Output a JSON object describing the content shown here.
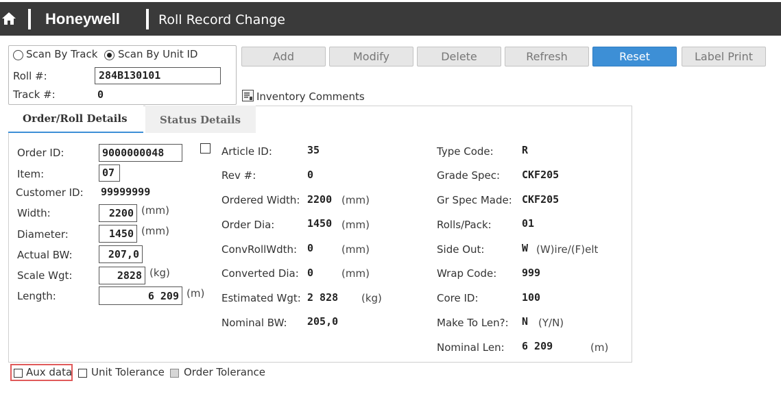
{
  "header": {
    "brand": "Honeywell",
    "title": "Roll Record Change",
    "home_icon": "home-icon"
  },
  "scan": {
    "option_track": "Scan By Track",
    "option_unit": "Scan By Unit ID",
    "selected": "unit",
    "roll_label": "Roll #:",
    "roll_value": "284B130101",
    "track_label": "Track #:",
    "track_value": "0"
  },
  "toolbar": {
    "add": "Add",
    "modify": "Modify",
    "delete": "Delete",
    "refresh": "Refresh",
    "reset": "Reset",
    "label_print": "Label Print"
  },
  "inventory_comments": "Inventory Comments",
  "tabs": {
    "order_roll": "Order/Roll Details",
    "status": "Status Details",
    "active": "order_roll"
  },
  "col1": {
    "order_id_label": "Order ID:",
    "order_id": "9000000048",
    "item_label": "Item:",
    "item": "07",
    "customer_id_label": "Customer ID:",
    "customer_id": "99999999",
    "width_label": "Width:",
    "width": "2200",
    "width_unit": "(mm)",
    "diameter_label": "Diameter:",
    "diameter": "1450",
    "diameter_unit": "(mm)",
    "actual_bw_label": "Actual BW:",
    "actual_bw": "207,0",
    "scale_wgt_label": "Scale Wgt:",
    "scale_wgt": "2828",
    "scale_wgt_unit": "(kg)",
    "length_label": "Length:",
    "length": "6 209",
    "length_unit": "(m)"
  },
  "col2": {
    "article_id_label": "Article ID:",
    "article_id": "35",
    "rev_label": "Rev #:",
    "rev": "0",
    "ordered_width_label": "Ordered Width:",
    "ordered_width": "2200",
    "ordered_width_unit": "(mm)",
    "order_dia_label": "Order Dia:",
    "order_dia": "1450",
    "order_dia_unit": "(mm)",
    "conv_roll_width_label": "ConvRollWdth:",
    "conv_roll_width": "0",
    "conv_roll_width_unit": "(mm)",
    "converted_dia_label": "Converted Dia:",
    "converted_dia": "0",
    "converted_dia_unit": "(mm)",
    "estimated_wgt_label": "Estimated Wgt:",
    "estimated_wgt": "2 828",
    "estimated_wgt_unit": "(kg)",
    "nominal_bw_label": "Nominal BW:",
    "nominal_bw": "205,0"
  },
  "col3": {
    "type_code_label": "Type Code:",
    "type_code": "R",
    "grade_spec_label": "Grade Spec:",
    "grade_spec": "CKF205",
    "gr_spec_made_label": "Gr Spec Made:",
    "gr_spec_made": "CKF205",
    "rolls_pack_label": "Rolls/Pack:",
    "rolls_pack": "01",
    "side_out_label": "Side Out:",
    "side_out": "W",
    "side_out_hint": "(W)ire/(F)elt",
    "wrap_code_label": "Wrap Code:",
    "wrap_code": "999",
    "core_id_label": "Core ID:",
    "core_id": "100",
    "make_to_len_label": "Make To Len?:",
    "make_to_len": "N",
    "make_to_len_hint": "(Y/N)",
    "nominal_len_label": "Nominal Len:",
    "nominal_len": "6 209",
    "nominal_len_unit": "(m)"
  },
  "footer": {
    "aux_data": "Aux data",
    "unit_tolerance": "Unit Tolerance",
    "order_tolerance": "Order Tolerance"
  },
  "colors": {
    "header_bg": "#3a3a3a",
    "primary": "#3d8fd6",
    "highlight": "#e05a5a"
  }
}
